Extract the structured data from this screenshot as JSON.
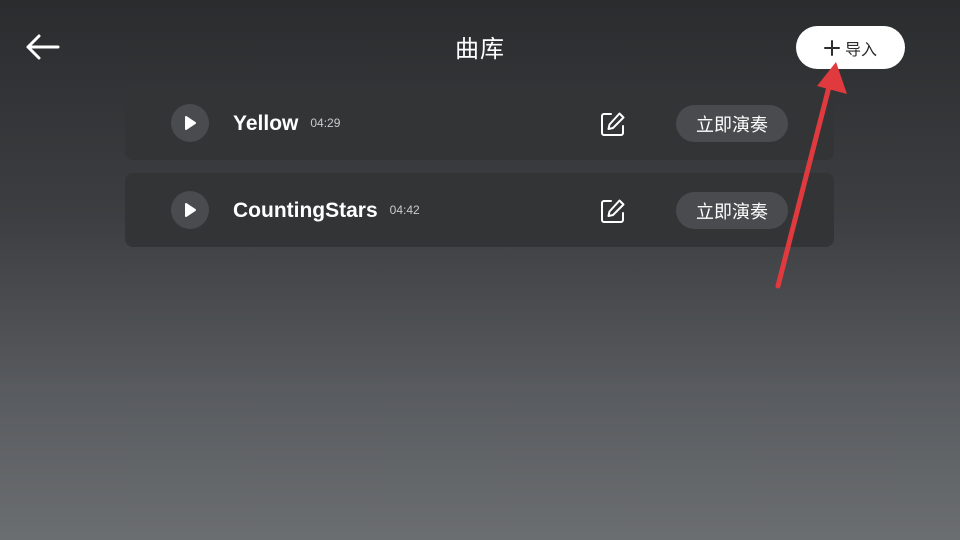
{
  "header": {
    "title": "曲库",
    "back_icon": "arrow-left-icon",
    "import_label": "导入",
    "import_icon": "plus-icon"
  },
  "songs": [
    {
      "name": "Yellow",
      "duration": "04:29",
      "play_now_label": "立即演奏"
    },
    {
      "name": "CountingStars",
      "duration": "04:42",
      "play_now_label": "立即演奏"
    }
  ],
  "colors": {
    "background_top": "#2b2c2e",
    "background_bottom": "#6b6e71",
    "row_background": "#333436",
    "button_background": "#4a4b4e",
    "import_button": "#ffffff",
    "annotation_arrow": "#e0393e"
  }
}
